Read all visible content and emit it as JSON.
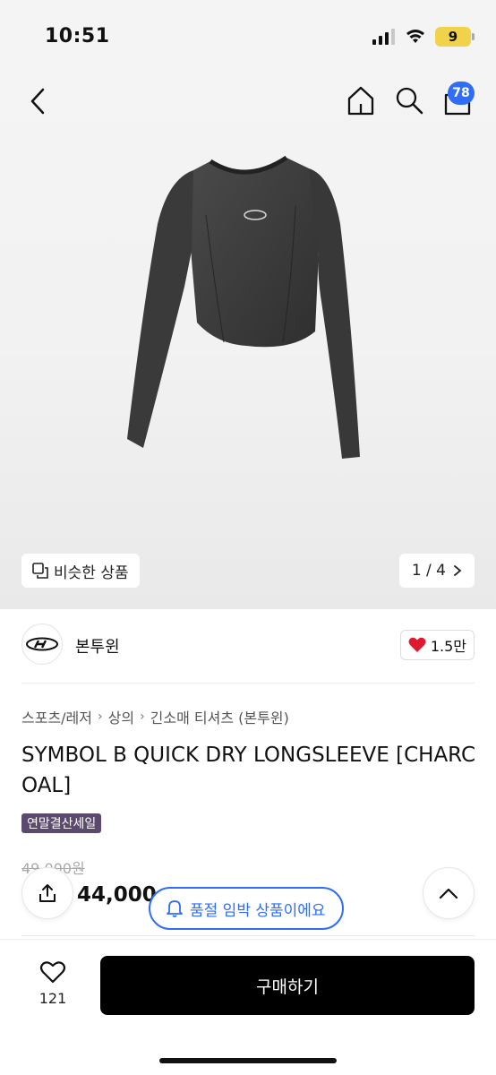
{
  "status_bar": {
    "time": "10:51",
    "battery": "9"
  },
  "nav": {
    "cart_count": "78"
  },
  "gallery": {
    "similar_label": "비슷한 상품",
    "pager": "1 / 4"
  },
  "brand": {
    "name": "본투윈",
    "likes": "1.5만"
  },
  "breadcrumb": [
    "스포츠/레저",
    "상의",
    "긴소매 티셔츠 (본투윈)"
  ],
  "product": {
    "title": "SYMBOL B QUICK DRY LONGSLEEVE [CHARCOAL]",
    "sale_badge": "연말결산세일",
    "original_price": "49,000원",
    "price": "44,000"
  },
  "toast": {
    "text": "품절 임박 상품이에요"
  },
  "bottom": {
    "wish_count": "121",
    "buy_label": "구매하기"
  },
  "colors": {
    "accent": "#2f6df6",
    "sale_badge": "#5b4a6e",
    "heart": "#e0192f",
    "buy": "#000000"
  },
  "icons": [
    "back-icon",
    "home-icon",
    "search-icon",
    "cart-icon",
    "similar-icon",
    "chevron-right-icon",
    "heart-icon",
    "share-icon",
    "bell-icon",
    "chevron-up-icon",
    "heart-outline-icon"
  ]
}
